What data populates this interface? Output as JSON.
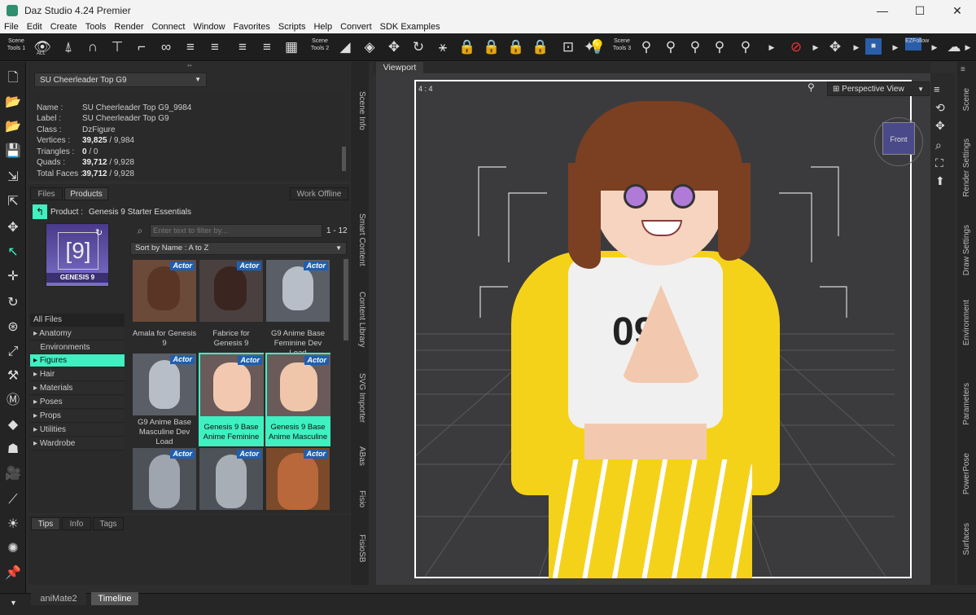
{
  "window": {
    "title": "Daz Studio 4.24 Premier",
    "controls": [
      "—",
      "☐",
      "✕"
    ]
  },
  "menu": [
    "File",
    "Edit",
    "Create",
    "Tools",
    "Render",
    "Connect",
    "Window",
    "Favorites",
    "Scripts",
    "Help",
    "Convert",
    "SDK Examples"
  ],
  "toolbar": {
    "scene_tools_1": "Scene Tools 1",
    "all_label": "ALL",
    "scene_tools_2": "Scene Tools 2",
    "scene_tools_3": "Scene Tools 3",
    "ezfollow": "EZFollow"
  },
  "scene_info": {
    "selected": "SU Cheerleader Top G9",
    "rows": [
      {
        "label": "Name :",
        "value": "SU Cheerleader Top G9_9984"
      },
      {
        "label": "Label :",
        "value": "SU Cheerleader Top G9"
      },
      {
        "label": "Class :",
        "value": "DzFigure"
      },
      {
        "label": "Vertices :",
        "value_bold": "39,825",
        "value_rest": " / 9,984"
      },
      {
        "label": "Triangles :",
        "value_bold": "0",
        "value_rest": " / 0"
      },
      {
        "label": "Quads :",
        "value_bold": "39,712",
        "value_rest": " / 9,928"
      },
      {
        "label": "Total Faces :",
        "value_bold": "39,712",
        "value_rest": " / 9,928"
      }
    ]
  },
  "smart_content": {
    "tabs": [
      "Files",
      "Products"
    ],
    "work_offline": "Work Offline",
    "product_label": "Product :",
    "product_name": "Genesis 9 Starter Essentials",
    "filter_placeholder": "Enter text to filter by...",
    "range": "1 - 12",
    "sort": "Sort by Name : A to Z",
    "product_thumb_text": "GENESIS 9",
    "product_thumb_glyph": "[9]",
    "categories": [
      "All Files",
      "Anatomy",
      "Environments",
      "Figures",
      "Hair",
      "Materials",
      "Poses",
      "Props",
      "Utilities",
      "Wardrobe"
    ],
    "badge": "Actor",
    "items": [
      {
        "label": "Amala for Genesis 9"
      },
      {
        "label": "Fabrice for Genesis 9"
      },
      {
        "label": "G9 Anime Base Feminine Dev Load"
      },
      {
        "label": "G9 Anime Base Masculine Dev Load"
      },
      {
        "label": "Genesis 9 Base Anime Feminine"
      },
      {
        "label": "Genesis 9 Base Anime Masculine"
      }
    ]
  },
  "bottom_left_tabs": [
    "Tips",
    "Info",
    "Tags"
  ],
  "side_tabs_left": [
    "Scene Info",
    "Smart Content",
    "Content Library",
    "SVG Importer",
    "ABas",
    "Fisio",
    "FisioSB"
  ],
  "side_tabs_right": [
    "Scene",
    "Render Settings",
    "Draw Settings",
    "Environment",
    "Parameters",
    "PowerPose",
    "Surfaces"
  ],
  "viewport": {
    "tab": "Viewport",
    "ratio": "4 : 4",
    "view": "Perspective View",
    "cube_face": "Front",
    "shirt_text": "09"
  },
  "bottom_tabs": [
    "aniMate2",
    "Timeline"
  ],
  "colors": {
    "accent": "#3ff0c0",
    "badge": "#1f5fb0",
    "yellow": "#f5d21a"
  }
}
